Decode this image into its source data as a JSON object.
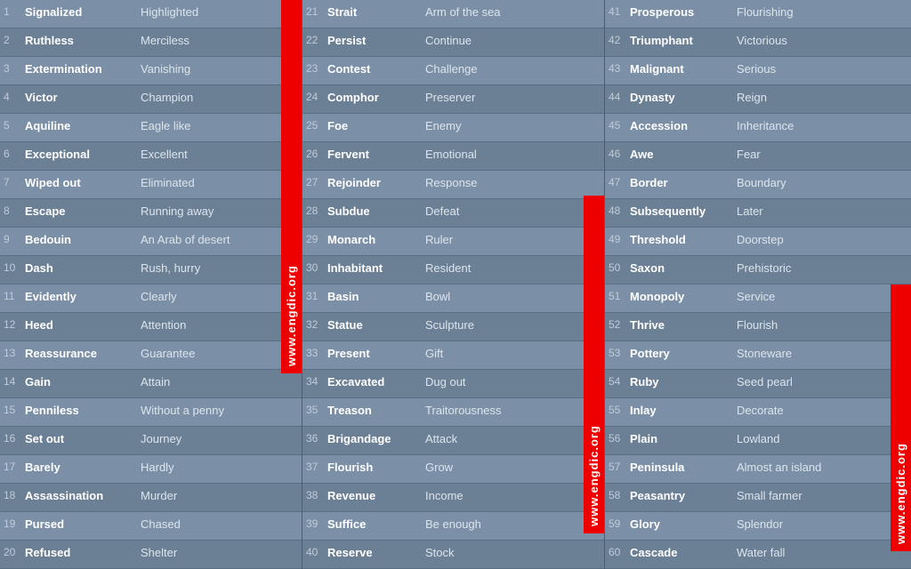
{
  "watermarks": [
    {
      "id": "wm1",
      "text": "www.engdic.org"
    },
    {
      "id": "wm2",
      "text": "www.engdic.org"
    },
    {
      "id": "wm3",
      "text": "www.engdic.org"
    }
  ],
  "col1": [
    {
      "num": "1",
      "word": "Signalized",
      "def": "Highlighted"
    },
    {
      "num": "2",
      "word": "Ruthless",
      "def": "Merciless"
    },
    {
      "num": "3",
      "word": "Extermination",
      "def": "Vanishing"
    },
    {
      "num": "4",
      "word": "Victor",
      "def": "Champion"
    },
    {
      "num": "5",
      "word": "Aquiline",
      "def": "Eagle like"
    },
    {
      "num": "6",
      "word": "Exceptional",
      "def": "Excellent"
    },
    {
      "num": "7",
      "word": "Wiped out",
      "def": "Eliminated"
    },
    {
      "num": "8",
      "word": "Escape",
      "def": "Running away"
    },
    {
      "num": "9",
      "word": "Bedouin",
      "def": "An Arab of desert"
    },
    {
      "num": "10",
      "word": "Dash",
      "def": "Rush, hurry"
    },
    {
      "num": "11",
      "word": "Evidently",
      "def": "Clearly"
    },
    {
      "num": "12",
      "word": "Heed",
      "def": "Attention"
    },
    {
      "num": "13",
      "word": "Reassurance",
      "def": "Guarantee"
    },
    {
      "num": "14",
      "word": "Gain",
      "def": "Attain"
    },
    {
      "num": "15",
      "word": "Penniless",
      "def": "Without a penny"
    },
    {
      "num": "16",
      "word": "Set out",
      "def": "Journey"
    },
    {
      "num": "17",
      "word": "Barely",
      "def": "Hardly"
    },
    {
      "num": "18",
      "word": "Assassination",
      "def": "Murder"
    },
    {
      "num": "19",
      "word": "Pursed",
      "def": "Chased"
    },
    {
      "num": "20",
      "word": "Refused",
      "def": "Shelter"
    }
  ],
  "col2": [
    {
      "num": "21",
      "word": "Strait",
      "def": "Arm of the sea"
    },
    {
      "num": "22",
      "word": "Persist",
      "def": "Continue"
    },
    {
      "num": "23",
      "word": "Contest",
      "def": "Challenge"
    },
    {
      "num": "24",
      "word": "Comphor",
      "def": "Preserver"
    },
    {
      "num": "25",
      "word": "Foe",
      "def": "Enemy"
    },
    {
      "num": "26",
      "word": "Fervent",
      "def": "Emotional"
    },
    {
      "num": "27",
      "word": "Rejoinder",
      "def": "Response"
    },
    {
      "num": "28",
      "word": "Subdue",
      "def": "Defeat"
    },
    {
      "num": "29",
      "word": "Monarch",
      "def": "Ruler"
    },
    {
      "num": "30",
      "word": "Inhabitant",
      "def": "Resident"
    },
    {
      "num": "31",
      "word": "Basin",
      "def": "Bowl"
    },
    {
      "num": "32",
      "word": "Statue",
      "def": "Sculpture"
    },
    {
      "num": "33",
      "word": "Present",
      "def": "Gift"
    },
    {
      "num": "34",
      "word": "Excavated",
      "def": "Dug out"
    },
    {
      "num": "35",
      "word": "Treason",
      "def": "Traitorousness"
    },
    {
      "num": "36",
      "word": "Brigandage",
      "def": "Attack"
    },
    {
      "num": "37",
      "word": "Flourish",
      "def": "Grow"
    },
    {
      "num": "38",
      "word": "Revenue",
      "def": "Income"
    },
    {
      "num": "39",
      "word": "Suffice",
      "def": "Be enough"
    },
    {
      "num": "40",
      "word": "Reserve",
      "def": "Stock"
    }
  ],
  "col3": [
    {
      "num": "41",
      "word": "Prosperous",
      "def": "Flourishing"
    },
    {
      "num": "42",
      "word": "Triumphant",
      "def": "Victorious"
    },
    {
      "num": "43",
      "word": "Malignant",
      "def": "Serious"
    },
    {
      "num": "44",
      "word": "Dynasty",
      "def": "Reign"
    },
    {
      "num": "45",
      "word": "Accession",
      "def": "Inheritance"
    },
    {
      "num": "46",
      "word": "Awe",
      "def": "Fear"
    },
    {
      "num": "47",
      "word": "Border",
      "def": "Boundary"
    },
    {
      "num": "48",
      "word": "Subsequently",
      "def": "Later"
    },
    {
      "num": "49",
      "word": "Threshold",
      "def": "Doorstep"
    },
    {
      "num": "50",
      "word": "Saxon",
      "def": "Prehistoric"
    },
    {
      "num": "51",
      "word": "Monopoly",
      "def": "Service"
    },
    {
      "num": "52",
      "word": "Thrive",
      "def": "Flourish"
    },
    {
      "num": "53",
      "word": "Pottery",
      "def": "Stoneware"
    },
    {
      "num": "54",
      "word": "Ruby",
      "def": "Seed pearl"
    },
    {
      "num": "55",
      "word": "Inlay",
      "def": "Decorate"
    },
    {
      "num": "56",
      "word": "Plain",
      "def": "Lowland"
    },
    {
      "num": "57",
      "word": "Peninsula",
      "def": "Almost an island"
    },
    {
      "num": "58",
      "word": "Peasantry",
      "def": "Small farmer"
    },
    {
      "num": "59",
      "word": "Glory",
      "def": "Splendor"
    },
    {
      "num": "60",
      "word": "Cascade",
      "def": "Water fall"
    }
  ]
}
